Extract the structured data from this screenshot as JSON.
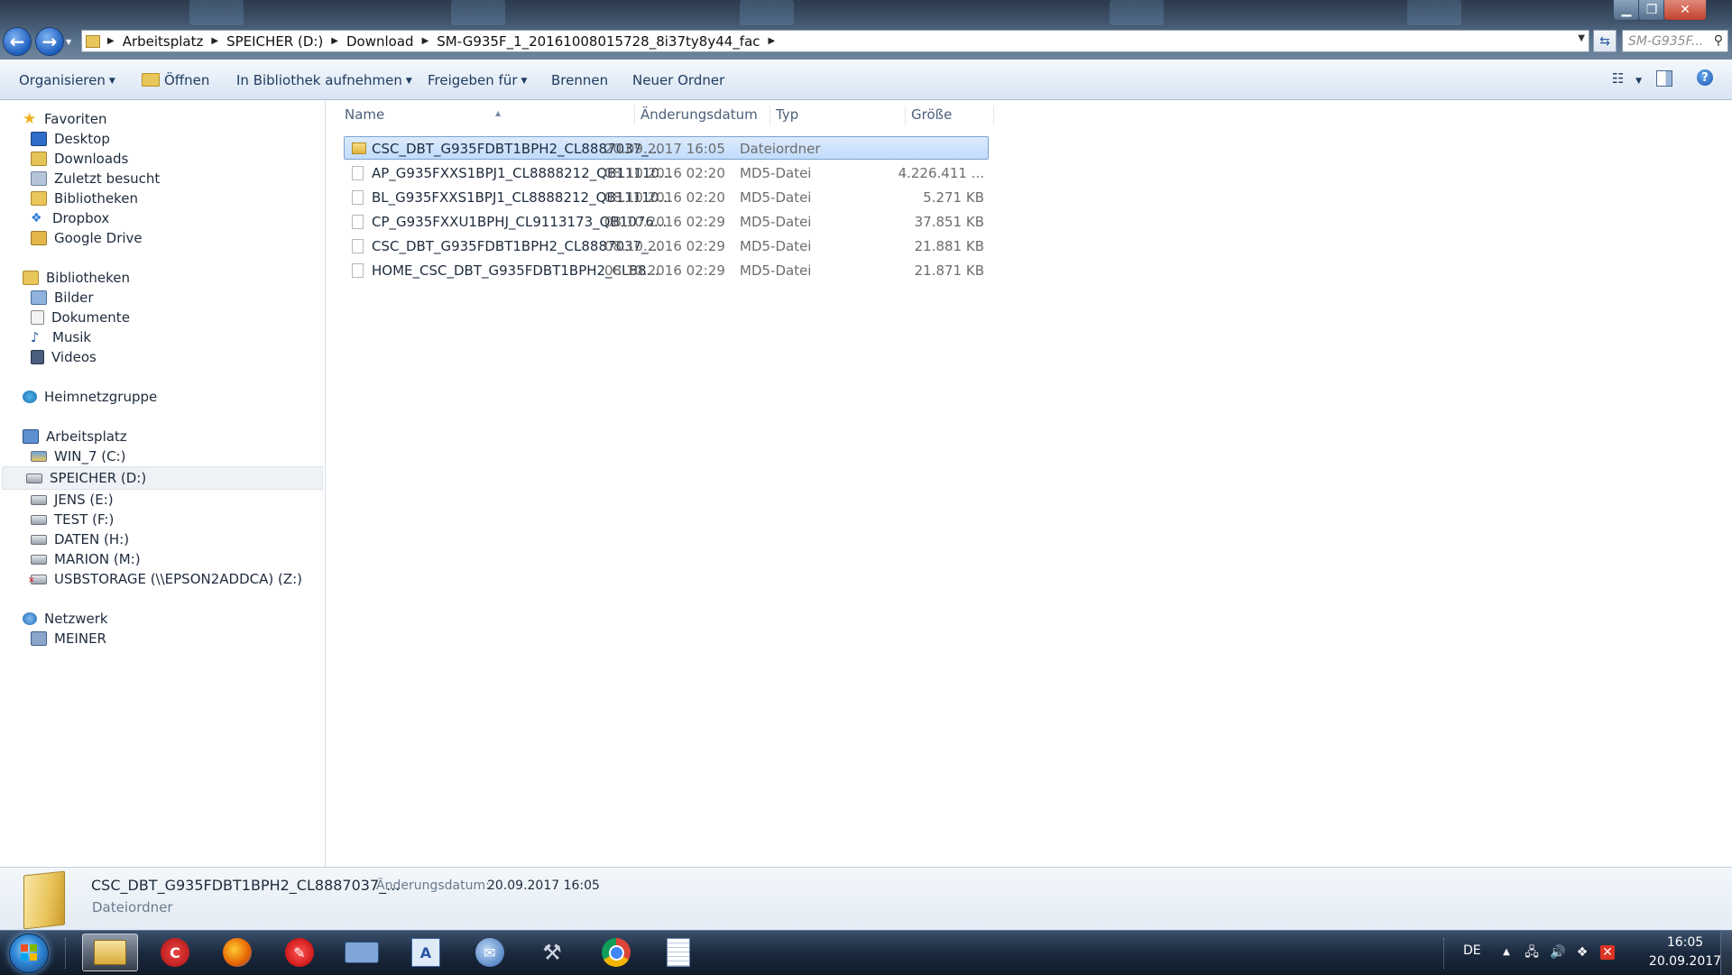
{
  "window": {
    "minimize_icon": "minimize-icon",
    "maximize_icon": "maximize-icon",
    "close_icon": "close-icon"
  },
  "address": {
    "crumbs": [
      "Arbeitsplatz",
      "SPEICHER (D:)",
      "Download",
      "SM-G935F_1_20161008015728_8i37ty8y44_fac"
    ]
  },
  "search": {
    "placeholder": "SM-G935F..."
  },
  "toolbar": {
    "organize": "Organisieren",
    "open": "Öffnen",
    "library": "In Bibliothek aufnehmen",
    "share": "Freigeben für",
    "burn": "Brennen",
    "new_folder": "Neuer Ordner"
  },
  "navpane": {
    "favorites": {
      "title": "Favoriten",
      "items": [
        "Desktop",
        "Downloads",
        "Zuletzt besucht",
        "Bibliotheken",
        "Dropbox",
        "Google Drive"
      ]
    },
    "libraries": {
      "title": "Bibliotheken",
      "items": [
        "Bilder",
        "Dokumente",
        "Musik",
        "Videos"
      ]
    },
    "homegroup": {
      "title": "Heimnetzgruppe"
    },
    "computer": {
      "title": "Arbeitsplatz",
      "items": [
        "WIN_7 (C:)",
        "SPEICHER (D:)",
        "JENS (E:)",
        "TEST (F:)",
        "DATEN (H:)",
        "MARION (M:)",
        "USBSTORAGE (\\\\EPSON2ADDCA) (Z:)"
      ],
      "selected": "SPEICHER (D:)"
    },
    "network": {
      "title": "Netzwerk",
      "items": [
        "MEINER"
      ]
    }
  },
  "columns": {
    "name": "Name",
    "date": "Änderungsdatum",
    "type": "Typ",
    "size": "Größe"
  },
  "files": [
    {
      "name": "CSC_DBT_G935FDBT1BPH2_CL8887037_...",
      "date": "20.09.2017 16:05",
      "type": "Dateiordner",
      "size": "",
      "kind": "folder",
      "selected": true
    },
    {
      "name": "AP_G935FXXS1BPJ1_CL8888212_QB11110...",
      "date": "08.10.2016 02:20",
      "type": "MD5-Datei",
      "size": "4.226.411 ...",
      "kind": "file"
    },
    {
      "name": "BL_G935FXXS1BPJ1_CL8888212_QB11110...",
      "date": "08.10.2016 02:20",
      "type": "MD5-Datei",
      "size": "5.271 KB",
      "kind": "file"
    },
    {
      "name": "CP_G935FXXU1BPHJ_CL9113173_QB1076...",
      "date": "08.10.2016 02:29",
      "type": "MD5-Datei",
      "size": "37.851 KB",
      "kind": "file"
    },
    {
      "name": "CSC_DBT_G935FDBT1BPH2_CL8887037_...",
      "date": "08.10.2016 02:29",
      "type": "MD5-Datei",
      "size": "21.881 KB",
      "kind": "file"
    },
    {
      "name": "HOME_CSC_DBT_G935FDBT1BPH2_CL88...",
      "date": "08.10.2016 02:29",
      "type": "MD5-Datei",
      "size": "21.871 KB",
      "kind": "file"
    }
  ],
  "details": {
    "name": "CSC_DBT_G935FDBT1BPH2_CL8887037_...",
    "date_label": "Änderungsdatum:",
    "date": "20.09.2017 16:05",
    "type": "Dateiordner"
  },
  "taskbar": {
    "apps": [
      "explorer",
      "ccleaner",
      "firefox",
      "paint",
      "keyboard",
      "wordpad",
      "thunderbird",
      "tool",
      "chrome",
      "notepad"
    ],
    "active": "explorer",
    "language": "DE",
    "time": "16:05",
    "date": "20.09.2017"
  },
  "colors": {
    "selection_bg": "#c9e0fb",
    "selection_border": "#7da2ce",
    "taskbar": "#1b2a3e"
  }
}
